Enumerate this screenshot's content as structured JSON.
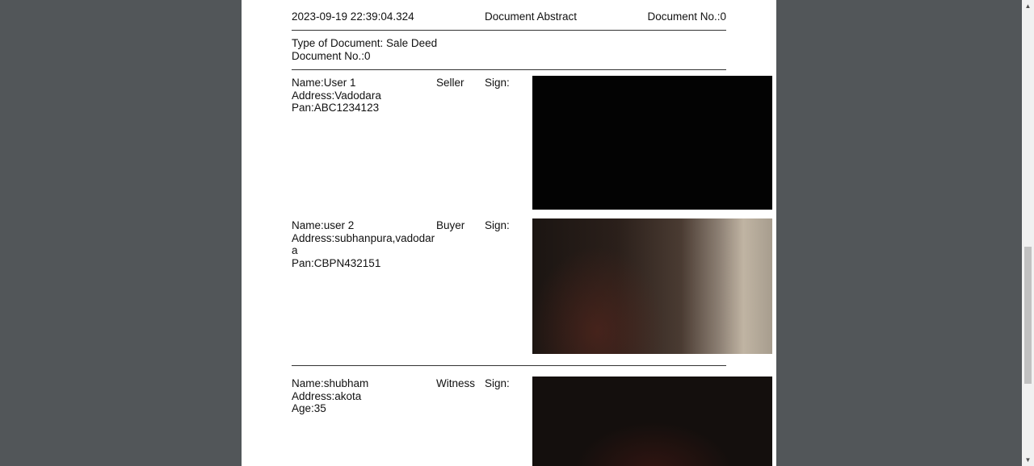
{
  "header": {
    "timestamp": "2023-09-19 22:39:04.324",
    "title": "Document Abstract",
    "doc_no": "Document No.:0"
  },
  "doc_info": {
    "type": "Type of Document: Sale Deed",
    "doc_no": "Document No.:0"
  },
  "parties": [
    {
      "name": "Name:User 1",
      "address": "Address:Vadodara",
      "extra": "Pan:ABC1234123",
      "role": "Seller",
      "sign": "Sign:"
    },
    {
      "name": "Name:user 2",
      "address_line1": "Address:subhanpura,vadodar",
      "address_line2": "a",
      "extra": "Pan:CBPN432151",
      "role": "Buyer",
      "sign": "Sign:"
    },
    {
      "name": "Name:shubham",
      "address": "Address:akota",
      "extra": "Age:35",
      "role": "Witness",
      "sign": "Sign:"
    }
  ],
  "scrollbar": {
    "up_icon": "triangle-up",
    "down_icon": "triangle-down"
  }
}
